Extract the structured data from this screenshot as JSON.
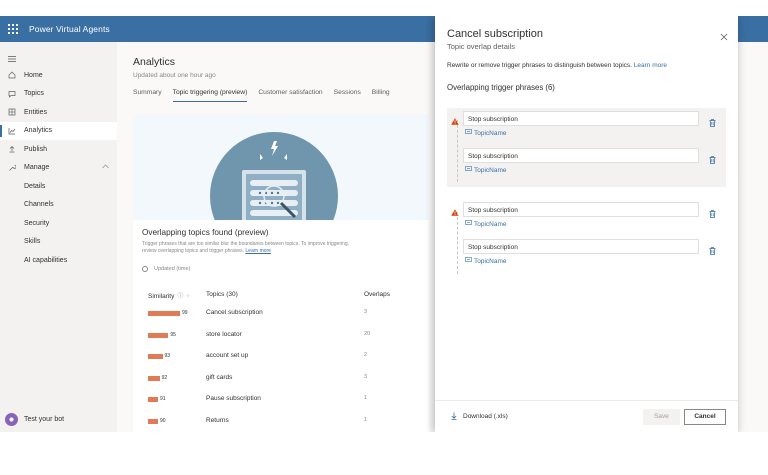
{
  "app": {
    "title": "Power Virtual Agents"
  },
  "sidebar": {
    "items": [
      {
        "label": "Home",
        "icon": "home-icon"
      },
      {
        "label": "Topics",
        "icon": "chat-icon"
      },
      {
        "label": "Entities",
        "icon": "entities-icon"
      },
      {
        "label": "Analytics",
        "icon": "analytics-icon",
        "active": true
      },
      {
        "label": "Publish",
        "icon": "publish-icon"
      },
      {
        "label": "Manage",
        "icon": "wrench-icon"
      }
    ],
    "sub_items": [
      "Details",
      "Channels",
      "Security",
      "Skills",
      "AI capabilities"
    ],
    "test_bot": "Test your bot"
  },
  "main": {
    "title": "Analytics",
    "subtitle": "Updated about one hour ago",
    "tabs": [
      "Summary",
      "Topic triggering (preview)",
      "Customer satisfaction",
      "Sessions",
      "Billing"
    ],
    "active_tab": 1,
    "overlap": {
      "title": "Overlapping topics found (preview)",
      "desc_line1": "Trigger phrases that are too similar blur the boundaries between topics. To improve triggering,",
      "desc_line2": "review overlapping topics and trigger phrases.",
      "learn_more": "Learn more",
      "updated": "Updated (time)"
    },
    "table": {
      "col_similarity": "Similarity",
      "col_topics": "Topics (30)",
      "col_overlaps": "Overlaps",
      "rows": [
        {
          "similarity": 99,
          "topic": "Cancel subscription",
          "overlaps": "3"
        },
        {
          "similarity": 95,
          "topic": "store locator",
          "overlaps": "20"
        },
        {
          "similarity": 93,
          "topic": "account set up",
          "overlaps": "2"
        },
        {
          "similarity": 92,
          "topic": "gift cards",
          "overlaps": "3"
        },
        {
          "similarity": 91,
          "topic": "Pause subscription",
          "overlaps": "1"
        },
        {
          "similarity": 90,
          "topic": "Returns",
          "overlaps": "1"
        }
      ]
    }
  },
  "panel": {
    "title": "Cancel subscription",
    "subtitle": "Topic overlap details",
    "desc": "Rewrite or remove trigger phrases to distinguish between topics.",
    "learn_more": "Learn more",
    "heading": "Overlapping trigger phrases (6)",
    "groups": [
      {
        "phrases": [
          {
            "text": "Stop subscription",
            "topic": "TopicName"
          },
          {
            "text": "Stop subscription",
            "topic": "TopicName"
          }
        ]
      },
      {
        "phrases": [
          {
            "text": "Stop subscription",
            "topic": "TopicName"
          },
          {
            "text": "Stop subscription",
            "topic": "TopicName"
          }
        ]
      }
    ],
    "download": "Download (.xls)",
    "save": "Save",
    "cancel": "Cancel"
  },
  "colors": {
    "brand": "#3a6fa3",
    "bar": "#e07b56",
    "warning": "#d83b01"
  }
}
